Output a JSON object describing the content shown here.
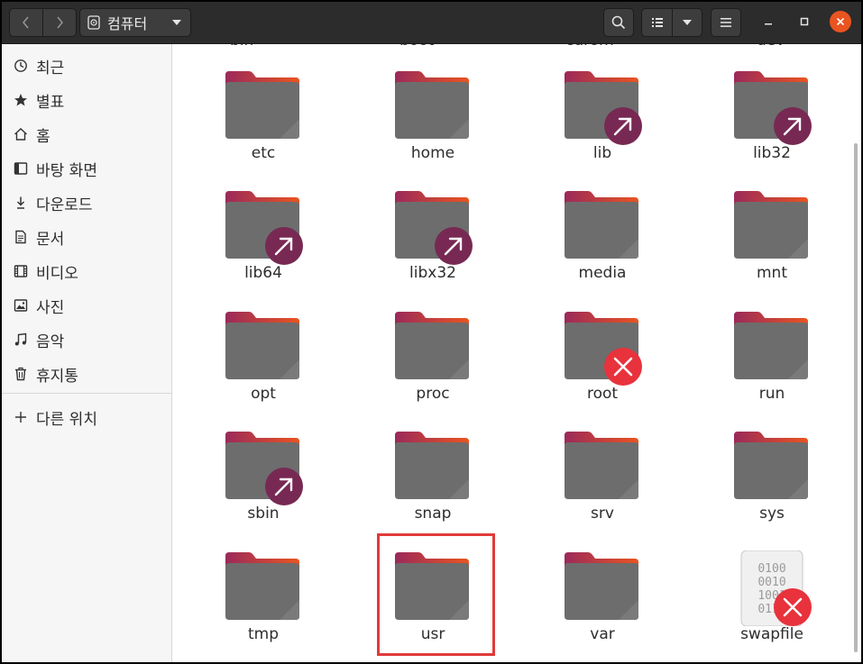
{
  "colors": {
    "headerbar": "#2c2c2c",
    "folder_body": "#6d6d6d",
    "folder_tab_left": "#9b2a5a",
    "folder_tab_right": "#e95420",
    "symlink_badge": "#772953",
    "no_access_badge": "#e8323c",
    "selection_outline": "#e03a3a"
  },
  "header": {
    "location_label": "컴퓨터",
    "location_icon": "drive-icon",
    "back_icon": "chevron-left-icon",
    "forward_icon": "chevron-right-icon",
    "search_icon": "search-icon",
    "list_view_icon": "list-view-icon",
    "view_menu_icon": "caret-down-icon",
    "menu_icon": "hamburger-menu-icon"
  },
  "sidebar": {
    "items": [
      {
        "label": "최근",
        "icon": "clock-icon"
      },
      {
        "label": "별표",
        "icon": "star-icon"
      },
      {
        "label": "홈",
        "icon": "home-icon"
      },
      {
        "label": "바탕 화면",
        "icon": "desktop-icon"
      },
      {
        "label": "다운로드",
        "icon": "download-icon"
      },
      {
        "label": "문서",
        "icon": "document-icon"
      },
      {
        "label": "비디오",
        "icon": "video-icon"
      },
      {
        "label": "사진",
        "icon": "picture-icon"
      },
      {
        "label": "음악",
        "icon": "music-icon"
      },
      {
        "label": "휴지통",
        "icon": "trash-icon"
      }
    ],
    "other_locations": {
      "label": "다른 위치",
      "icon": "plus-icon"
    }
  },
  "files": {
    "cut_top_row": [
      "bin",
      "boot",
      "cdrom",
      "dev"
    ],
    "items": [
      {
        "name": "etc",
        "type": "folder",
        "badge": ""
      },
      {
        "name": "home",
        "type": "folder",
        "badge": ""
      },
      {
        "name": "lib",
        "type": "folder",
        "badge": "symlink"
      },
      {
        "name": "lib32",
        "type": "folder",
        "badge": "symlink"
      },
      {
        "name": "lib64",
        "type": "folder",
        "badge": "symlink"
      },
      {
        "name": "libx32",
        "type": "folder",
        "badge": "symlink"
      },
      {
        "name": "media",
        "type": "folder",
        "badge": ""
      },
      {
        "name": "mnt",
        "type": "folder",
        "badge": ""
      },
      {
        "name": "opt",
        "type": "folder",
        "badge": ""
      },
      {
        "name": "proc",
        "type": "folder",
        "badge": ""
      },
      {
        "name": "root",
        "type": "folder",
        "badge": "no-access"
      },
      {
        "name": "run",
        "type": "folder",
        "badge": ""
      },
      {
        "name": "sbin",
        "type": "folder",
        "badge": "symlink"
      },
      {
        "name": "snap",
        "type": "folder",
        "badge": ""
      },
      {
        "name": "srv",
        "type": "folder",
        "badge": ""
      },
      {
        "name": "sys",
        "type": "folder",
        "badge": ""
      },
      {
        "name": "tmp",
        "type": "folder",
        "badge": ""
      },
      {
        "name": "usr",
        "type": "folder",
        "badge": "",
        "highlighted": true
      },
      {
        "name": "var",
        "type": "folder",
        "badge": ""
      },
      {
        "name": "swapfile",
        "type": "binary-file",
        "badge": "no-access",
        "binary_text": [
          "0100",
          "0010",
          "1001",
          "0110"
        ]
      }
    ]
  }
}
